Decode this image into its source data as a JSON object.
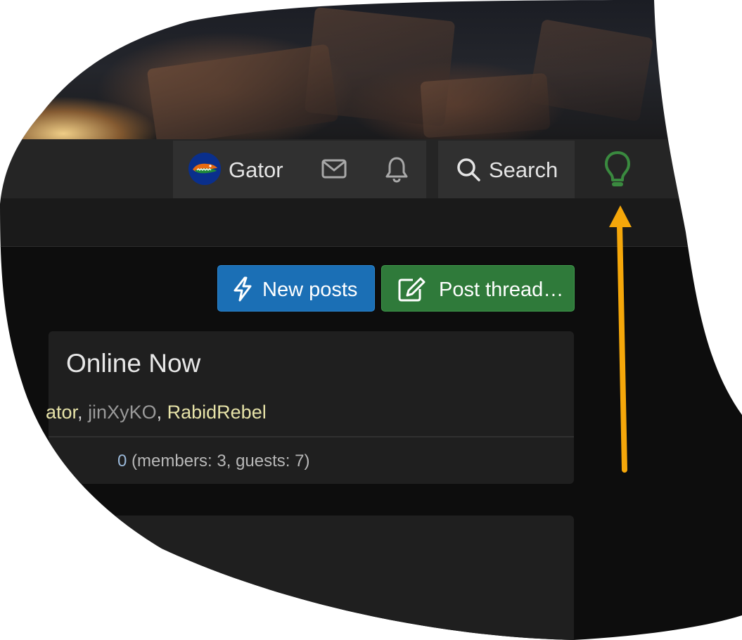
{
  "header": {
    "user_name": "Gator",
    "search_label": "Search",
    "icons": {
      "avatar": "florida-gators-avatar",
      "inbox": "envelope-icon",
      "alerts": "bell-icon",
      "search": "search-icon",
      "style_toggle": "lightbulb-icon"
    }
  },
  "actions": {
    "new_posts_label": "New posts",
    "post_thread_label": "Post thread…"
  },
  "online_now": {
    "title": "Online Now",
    "users": [
      {
        "name": "ator",
        "color": "#e7e3a8"
      },
      {
        "name": "jinXyKO",
        "color": "#9a9a9a"
      },
      {
        "name": "RabidRebel",
        "color": "#e7e3a8"
      }
    ],
    "separator": ", ",
    "stats_prefix": "0",
    "stats": "(members: 3, guests: 7)"
  },
  "colors": {
    "accent_blue": "#1b6fb5",
    "accent_green": "#2f7a3a",
    "lightbulb_green": "#3a8a3f",
    "annotation_arrow": "#f5a70a",
    "navbar_bg": "#252525",
    "page_bg": "#0d0d0d"
  }
}
